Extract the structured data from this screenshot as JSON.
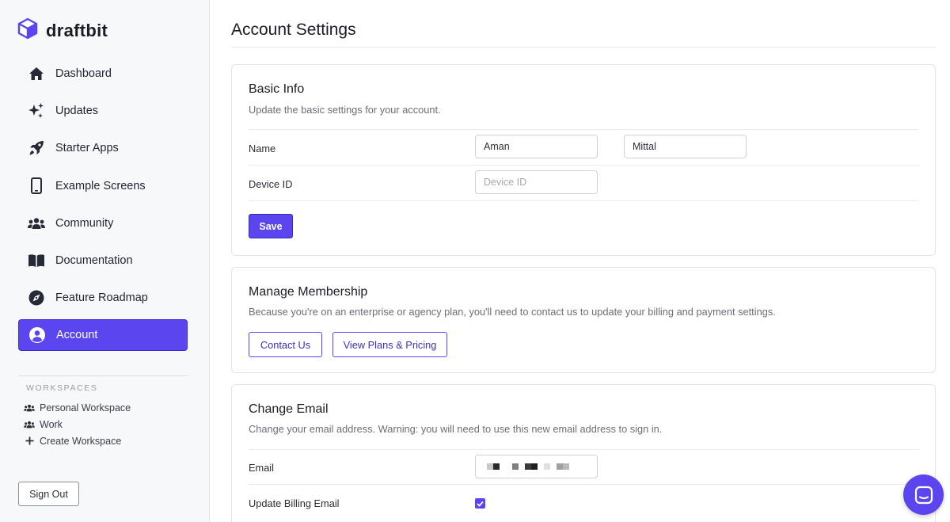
{
  "app": {
    "name": "draftbit"
  },
  "sidebar": {
    "items": [
      {
        "label": "Dashboard",
        "icon": "home-icon"
      },
      {
        "label": "Updates",
        "icon": "sparkles-icon"
      },
      {
        "label": "Starter Apps",
        "icon": "rocket-icon"
      },
      {
        "label": "Example Screens",
        "icon": "mobile-icon"
      },
      {
        "label": "Community",
        "icon": "users-icon"
      },
      {
        "label": "Documentation",
        "icon": "book-icon"
      },
      {
        "label": "Feature Roadmap",
        "icon": "compass-icon"
      },
      {
        "label": "Account",
        "icon": "user-circle-icon",
        "active": true
      }
    ],
    "workspaces_title": "WORKSPACES",
    "workspaces": [
      {
        "label": "Personal Workspace",
        "icon": "users-icon"
      },
      {
        "label": "Work",
        "icon": "users-icon"
      },
      {
        "label": "Create Workspace",
        "icon": "plus-icon"
      }
    ],
    "sign_out": "Sign Out"
  },
  "main": {
    "title": "Account Settings",
    "basic_info": {
      "title": "Basic Info",
      "description": "Update the basic settings for your account.",
      "name_label": "Name",
      "first_name": "Aman",
      "last_name": "Mittal",
      "device_label": "Device ID",
      "device_placeholder": "Device ID",
      "save": "Save"
    },
    "membership": {
      "title": "Manage Membership",
      "description": "Because you're on an enterprise or agency plan, you'll need to contact us to update your billing and payment settings.",
      "contact": "Contact Us",
      "plans": "View Plans & Pricing"
    },
    "change_email": {
      "title": "Change Email",
      "description": "Change your email address. Warning: you will need to use this new email address to sign in.",
      "email_label": "Email",
      "billing_label": "Update Billing Email",
      "billing_checked": true
    }
  },
  "colors": {
    "accent": "#5a45ef",
    "sidebar_bg": "#f7f8fa"
  }
}
